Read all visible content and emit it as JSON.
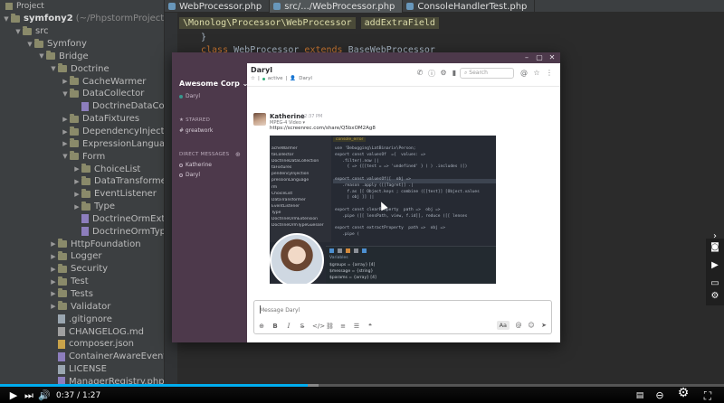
{
  "ide": {
    "project_tab": "Project",
    "tabs": [
      {
        "label": "WebProcessor.php",
        "active": false
      },
      {
        "label": "src/.../WebProcessor.php",
        "active": true
      },
      {
        "label": "ConsoleHandlerTest.php",
        "active": false
      }
    ],
    "tree": [
      {
        "depth": 0,
        "arrow": "down",
        "kind": "folder",
        "label": "symfony2",
        "dim": "(~/PhpstormProjects/symfo",
        "bold": true
      },
      {
        "depth": 1,
        "arrow": "down",
        "kind": "folder",
        "label": "src"
      },
      {
        "depth": 2,
        "arrow": "down",
        "kind": "folder",
        "label": "Symfony"
      },
      {
        "depth": 3,
        "arrow": "down",
        "kind": "folder",
        "label": "Bridge"
      },
      {
        "depth": 4,
        "arrow": "down",
        "kind": "folder",
        "label": "Doctrine"
      },
      {
        "depth": 5,
        "arrow": "right",
        "kind": "folder",
        "label": "CacheWarmer"
      },
      {
        "depth": 5,
        "arrow": "down",
        "kind": "folder",
        "label": "DataCollector"
      },
      {
        "depth": 6,
        "arrow": "none",
        "kind": "php",
        "label": "DoctrineDataCollec"
      },
      {
        "depth": 5,
        "arrow": "right",
        "kind": "folder",
        "label": "DataFixtures"
      },
      {
        "depth": 5,
        "arrow": "right",
        "kind": "folder",
        "label": "DependencyInjection"
      },
      {
        "depth": 5,
        "arrow": "right",
        "kind": "folder",
        "label": "ExpressionLanguage"
      },
      {
        "depth": 5,
        "arrow": "down",
        "kind": "folder",
        "label": "Form"
      },
      {
        "depth": 6,
        "arrow": "right",
        "kind": "folder",
        "label": "ChoiceList"
      },
      {
        "depth": 6,
        "arrow": "right",
        "kind": "folder",
        "label": "DataTransformer"
      },
      {
        "depth": 6,
        "arrow": "right",
        "kind": "folder",
        "label": "EventListener"
      },
      {
        "depth": 6,
        "arrow": "right",
        "kind": "folder",
        "label": "Type"
      },
      {
        "depth": 6,
        "arrow": "none",
        "kind": "php",
        "label": "DoctrineOrmExtens"
      },
      {
        "depth": 6,
        "arrow": "none",
        "kind": "php",
        "label": "DoctrineOrmTypeG"
      },
      {
        "depth": 4,
        "arrow": "right",
        "kind": "folder",
        "label": "HttpFoundation"
      },
      {
        "depth": 4,
        "arrow": "right",
        "kind": "folder",
        "label": "Logger"
      },
      {
        "depth": 4,
        "arrow": "right",
        "kind": "folder",
        "label": "Security"
      },
      {
        "depth": 4,
        "arrow": "right",
        "kind": "folder",
        "label": "Test"
      },
      {
        "depth": 4,
        "arrow": "right",
        "kind": "folder",
        "label": "Tests"
      },
      {
        "depth": 4,
        "arrow": "right",
        "kind": "folder",
        "label": "Validator"
      },
      {
        "depth": 4,
        "arrow": "none",
        "kind": "file",
        "label": ".gitignore"
      },
      {
        "depth": 4,
        "arrow": "none",
        "kind": "md",
        "label": "CHANGELOG.md"
      },
      {
        "depth": 4,
        "arrow": "none",
        "kind": "json",
        "label": "composer.json"
      },
      {
        "depth": 4,
        "arrow": "none",
        "kind": "php",
        "label": "ContainerAwareEventM"
      },
      {
        "depth": 4,
        "arrow": "none",
        "kind": "file",
        "label": "LICENSE"
      },
      {
        "depth": 4,
        "arrow": "none",
        "kind": "php",
        "label": "ManagerRegistry.php"
      }
    ],
    "breadcrumbs": [
      "\\Monolog\\Processor\\WebProcessor",
      "addExtraField"
    ],
    "code": {
      "line1": "}",
      "line2_kw1": "class",
      "line2_name": "WebProcessor",
      "line2_kw2": "extends",
      "line2_parent": "BaseWebProcessor"
    }
  },
  "slack": {
    "team_name": "Awesome Corp",
    "team_user": "Daryl",
    "starred_label": "STARRED",
    "starred_item": "# greatwork",
    "dm_label": "DIRECT MESSAGES",
    "dm_items": [
      "Katherine",
      "Daryl"
    ],
    "channel_name": "Daryl",
    "channel_status": "active",
    "channel_user": "Daryl",
    "search_placeholder": "Search",
    "message": {
      "author": "Katherine",
      "time": "12:37 PM",
      "sub": "MPEG-4 Video",
      "link": "https://screenrec.com/share/Q5bxOM2Ag8"
    },
    "preview": {
      "crumb": "console_error",
      "tree_rows": [
        "acheWarmer",
        "taCollector",
        "DoctrineDataCollection",
        "taFixtures",
        "pendencyInjection",
        "pressionLanguage",
        "rm",
        "ChoiceList",
        "DataTransformer",
        "EventListener",
        "Type",
        "DoctrineOrmExtension",
        "DoctrineOrmTypeGuesser"
      ],
      "code_lines": [
        "use 'Debugging\\LatBinarix\\Person;",
        "export const valuesOf  ={  values: =>",
        "   .filter(.now ||",
        "     { => {[[test = => 'undefined' } ) ) .includes ([)",
        "",
        "export const valuesOf([  obj =>",
        "   .reason .apply ([[Tagret]] .|",
        "     f.as [[ Object.keys ; combine ([[test]] [Object.values",
        "     | obj ]] ||",
        "",
        "export const clearProperty  path =>  obj =>",
        "   .pipe ([[ lensPath, view, f.id]], reduce ([[ lenses",
        "",
        "export const extractProperty  path =>  obj =>",
        "   .pipe ("
      ],
      "debug_vars": [
        "$groups = {array} [4]",
        "$message = {string}",
        "$params = {array} [4]"
      ],
      "debug_tab": "Variables"
    },
    "composer_placeholder": "Message Daryl",
    "composer_aa": "Aa"
  },
  "player": {
    "time_current": "0:37",
    "time_total": "1:27",
    "time_separator": " / ",
    "progress": 0.425,
    "buffered": 0.44,
    "accent_color": "#00adef"
  }
}
